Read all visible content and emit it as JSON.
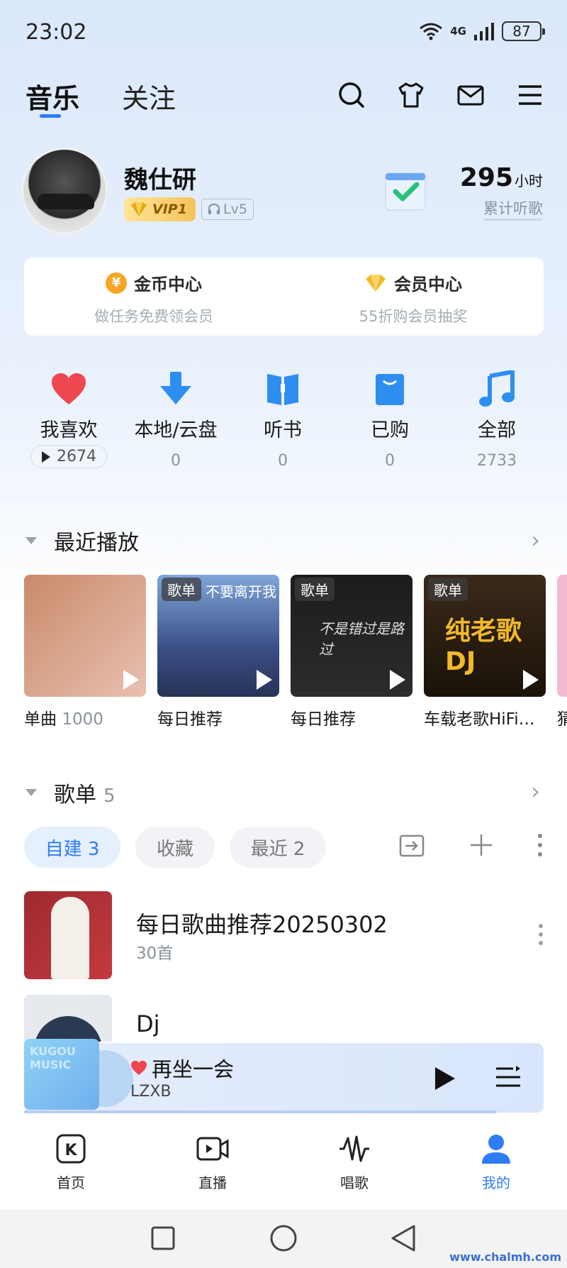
{
  "status": {
    "time": "23:02",
    "network": "4G",
    "battery": "87"
  },
  "top_tabs": {
    "active": "音乐",
    "other": "关注"
  },
  "icons": {
    "search": "search-icon",
    "skin": "tshirt-icon",
    "mail": "mail-icon",
    "menu": "menu-icon"
  },
  "profile": {
    "name": "魏仕研",
    "vip": "VIP1",
    "level": "Lv5",
    "hours_value": "295",
    "hours_unit": "小时",
    "hours_label": "累计听歌"
  },
  "center": {
    "coins": {
      "title": "金币中心",
      "subtitle": "做任务免费领会员",
      "icon": "¥"
    },
    "vip": {
      "title": "会员中心",
      "subtitle": "55折购会员抽奖"
    }
  },
  "quick": [
    {
      "label": "我喜欢",
      "count": "2674",
      "icon": "heart-icon"
    },
    {
      "label": "本地/云盘",
      "count": "0",
      "icon": "download-arrow-icon"
    },
    {
      "label": "听书",
      "count": "0",
      "icon": "book-icon"
    },
    {
      "label": "已购",
      "count": "0",
      "icon": "shopping-bag-icon"
    },
    {
      "label": "全部",
      "count": "2733",
      "icon": "music-note-icon"
    }
  ],
  "recent": {
    "title": "最近播放",
    "items": [
      {
        "label": "单曲",
        "sub": "1000",
        "tag": ""
      },
      {
        "label": "每日推荐",
        "sub": "",
        "tag": "歌单",
        "cover_text": "不要离开我"
      },
      {
        "label": "每日推荐",
        "sub": "",
        "tag": "歌单",
        "cover_text": "不是错过是路过"
      },
      {
        "label": "车载老歌HiFi…",
        "sub": "",
        "tag": "歌单",
        "cover_text": "纯老歌 DJ"
      }
    ],
    "partial_label": "猜"
  },
  "playlists": {
    "title": "歌单",
    "count": "5",
    "chips": [
      {
        "label": "自建 3",
        "active": true
      },
      {
        "label": "收藏",
        "active": false
      },
      {
        "label": "最近 2",
        "active": false
      }
    ],
    "items": [
      {
        "title": "每日歌曲推荐20250302",
        "sub": "30首"
      },
      {
        "title": "Dj",
        "sub": ""
      }
    ]
  },
  "player": {
    "title": "再坐一会",
    "artist": "LZXB",
    "cover_text": "KUGOU MUSIC",
    "progress": 0.91
  },
  "bottom_nav": [
    {
      "label": "首页",
      "active": false
    },
    {
      "label": "直播",
      "active": false
    },
    {
      "label": "唱歌",
      "active": false
    },
    {
      "label": "我的",
      "active": true
    }
  ],
  "watermark": "www.chalmh.com",
  "colors": {
    "accent": "#2e7cf6",
    "heart": "#f0464f",
    "gold": "#f6a623"
  }
}
